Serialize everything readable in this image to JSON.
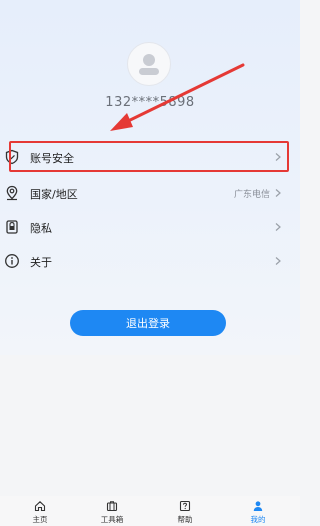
{
  "profile": {
    "phone": "132****5898"
  },
  "menu": {
    "account_security": "账号安全",
    "region_label": "国家/地区",
    "region_value": "广东电信",
    "privacy": "隐私",
    "about": "关于"
  },
  "logout_label": "退出登录",
  "tabs": [
    {
      "label": "主页"
    },
    {
      "label": "工具箱"
    },
    {
      "label": "帮助"
    },
    {
      "label": "我的"
    }
  ],
  "colors": {
    "accent": "#1e88f3",
    "highlight": "#e53935"
  }
}
